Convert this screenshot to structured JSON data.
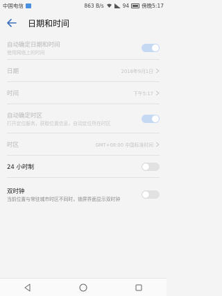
{
  "status_bar": {
    "carrier": "中国电信",
    "speed": "863 B/s",
    "battery_percent": "94",
    "carrier_right": "傍晚5:17"
  },
  "header": {
    "title": "日期和时间"
  },
  "settings": [
    {
      "id": "auto-datetime",
      "title": "自动确定日期和时间",
      "subtitle": "使用网络上的时间",
      "toggle": true,
      "enabled": false
    },
    {
      "id": "date",
      "title": "日期",
      "value": "2018年9月1日",
      "enabled": false
    },
    {
      "id": "time",
      "title": "时间",
      "value": "下午5:17",
      "enabled": false
    },
    {
      "id": "auto-timezone",
      "title": "自动确定时区",
      "subtitle": "打开定位服务，获取位置信息，自动定位所在时区",
      "toggle": true,
      "enabled": false
    },
    {
      "id": "timezone",
      "title": "时区",
      "value": "GMT+08:00 中国标准时间",
      "enabled": false
    },
    {
      "id": "24h",
      "title": "24 小时制",
      "toggle": false,
      "enabled": true
    },
    {
      "id": "dual-clock",
      "title": "双时钟",
      "subtitle": "当前位置与常驻城市时区不同时，锁屏界面显示双时钟",
      "toggle": false,
      "enabled": true
    }
  ],
  "colors": {
    "accent": "#3b6fb8",
    "toggle_on_disabled": "#c6d9f2",
    "toggle_off": "#e2e2e2"
  }
}
